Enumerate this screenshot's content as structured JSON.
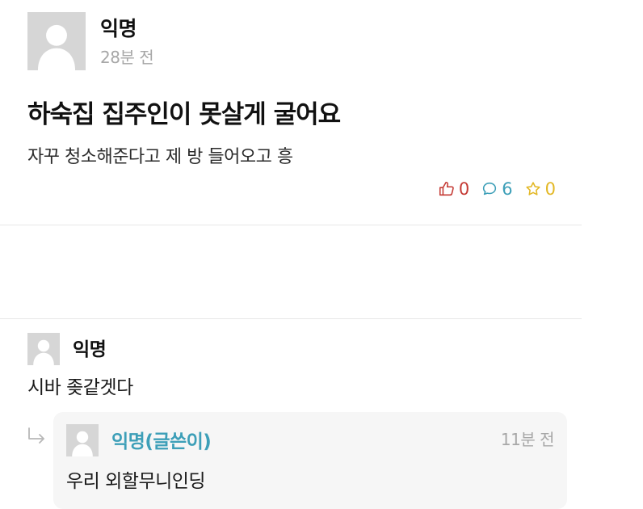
{
  "post": {
    "author": "익명",
    "time": "28분 전",
    "title": "하숙집 집주인이 못살게 굴어요",
    "body": "자꾸 청소해준다고 제 방 들어오고 흥",
    "stats": {
      "likes": "0",
      "comments": "6",
      "scraps": "0"
    },
    "icons": {
      "avatar": "default-user-avatar-icon",
      "like": "thumbs-up-icon",
      "comment": "speech-bubble-icon",
      "scrap": "star-icon"
    }
  },
  "comments": [
    {
      "author": "익명",
      "text": "시바 좆같겟다",
      "reply": {
        "author": "익명(글쓴이)",
        "time": "11분 전",
        "text": "우리 외할무니인딩"
      }
    }
  ],
  "colors": {
    "like": "#c53b35",
    "comment": "#3d9fb8",
    "scrap": "#e3b825",
    "writer": "#3d9fb8",
    "muted": "#a7a7a7",
    "avatar_bg": "#d6d6d6",
    "reply_bg": "#f6f6f6"
  }
}
